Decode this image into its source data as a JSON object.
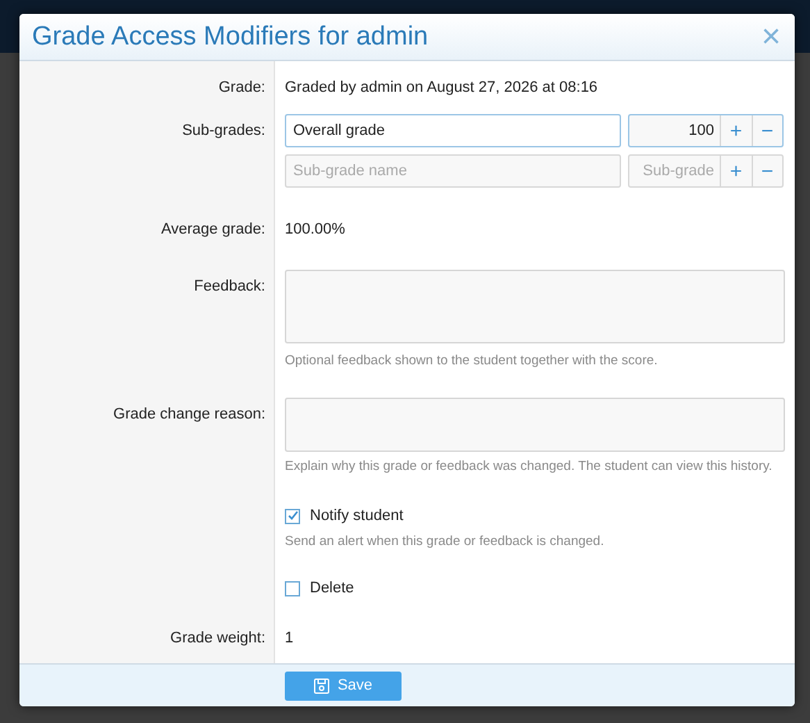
{
  "dialog": {
    "title": "Grade Access Modifiers for admin",
    "close": "×"
  },
  "grade": {
    "label": "Grade:",
    "value": "Graded by admin on August 27, 2026 at 08:16"
  },
  "sub_grades": {
    "label": "Sub-grades:",
    "rows": [
      {
        "name": "Overall grade",
        "score": "100",
        "focused": true,
        "plus": "+",
        "minus": "−"
      },
      {
        "name_placeholder": "Sub-grade name",
        "score_placeholder": "Sub-grade",
        "focused": false,
        "plus": "+",
        "minus": "−"
      }
    ]
  },
  "average": {
    "label": "Average grade:",
    "value": "100.00%"
  },
  "feedback": {
    "label": "Feedback:",
    "help": "Optional feedback shown to the student together with the score."
  },
  "reason": {
    "label": "Grade change reason:",
    "help": "Explain why this grade or feedback was changed. The student can view this history."
  },
  "notify": {
    "label": "Notify student",
    "checked": true,
    "help": "Send an alert when this grade or feedback is changed."
  },
  "delete": {
    "label": "Delete",
    "checked": false
  },
  "weight": {
    "label": "Grade weight:",
    "value": "1"
  },
  "save_button": "Save"
}
